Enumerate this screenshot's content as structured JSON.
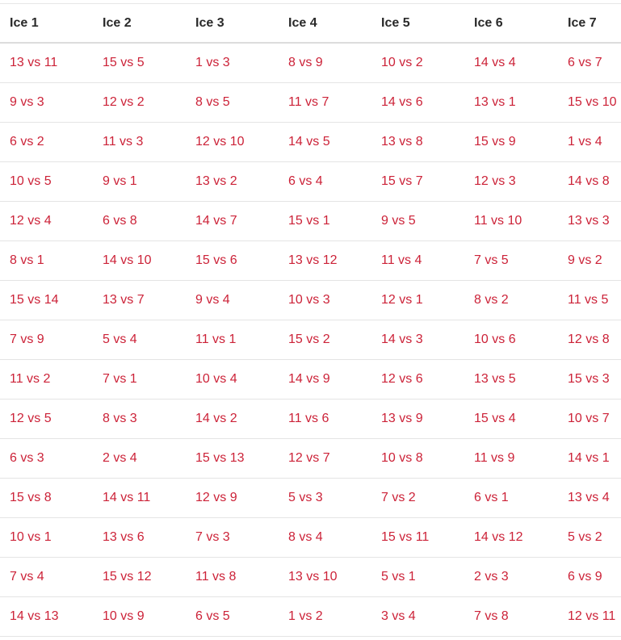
{
  "table": {
    "headers": [
      "Ice 1",
      "Ice 2",
      "Ice 3",
      "Ice 4",
      "Ice 5",
      "Ice 6",
      "Ice 7"
    ],
    "rows": [
      [
        "13 vs 11",
        "15 vs 5",
        "1 vs 3",
        "8 vs 9",
        "10 vs 2",
        "14 vs 4",
        "6 vs 7"
      ],
      [
        "9 vs 3",
        "12 vs 2",
        "8 vs 5",
        "11 vs 7",
        "14 vs 6",
        "13 vs 1",
        "15 vs 10"
      ],
      [
        "6 vs 2",
        "11 vs 3",
        "12 vs 10",
        "14 vs 5",
        "13 vs 8",
        "15 vs 9",
        "1 vs 4"
      ],
      [
        "10 vs 5",
        "9 vs 1",
        "13 vs 2",
        "6 vs 4",
        "15 vs 7",
        "12 vs 3",
        "14 vs 8"
      ],
      [
        "12 vs 4",
        "6 vs 8",
        "14 vs 7",
        "15 vs 1",
        "9 vs 5",
        "11 vs 10",
        "13 vs 3"
      ],
      [
        "8 vs 1",
        "14 vs 10",
        "15 vs 6",
        "13 vs 12",
        "11 vs 4",
        "7 vs 5",
        "9 vs 2"
      ],
      [
        "15 vs 14",
        "13 vs 7",
        "9 vs 4",
        "10 vs 3",
        "12 vs 1",
        "8 vs 2",
        "11 vs 5"
      ],
      [
        "7 vs 9",
        "5 vs 4",
        "11 vs 1",
        "15 vs 2",
        "14 vs 3",
        "10 vs 6",
        "12 vs 8"
      ],
      [
        "11 vs 2",
        "7 vs 1",
        "10 vs 4",
        "14 vs 9",
        "12 vs 6",
        "13 vs 5",
        "15 vs 3"
      ],
      [
        "12 vs 5",
        "8 vs 3",
        "14 vs 2",
        "11 vs 6",
        "13 vs 9",
        "15 vs 4",
        "10 vs 7"
      ],
      [
        "6 vs 3",
        "2 vs 4",
        "15 vs 13",
        "12 vs 7",
        "10 vs 8",
        "11 vs 9",
        "14 vs 1"
      ],
      [
        "15 vs 8",
        "14 vs 11",
        "12 vs 9",
        "5 vs 3",
        "7 vs 2",
        "6 vs 1",
        "13 vs 4"
      ],
      [
        "10 vs 1",
        "13 vs 6",
        "7 vs 3",
        "8 vs 4",
        "15 vs 11",
        "14 vs 12",
        "5 vs 2"
      ],
      [
        "7 vs 4",
        "15 vs 12",
        "11 vs 8",
        "13 vs 10",
        "5 vs 1",
        "2 vs 3",
        "6 vs 9"
      ],
      [
        "14 vs 13",
        "10 vs 9",
        "6 vs 5",
        "1 vs 2",
        "3 vs 4",
        "7 vs 8",
        "12 vs 11"
      ]
    ]
  },
  "colors": {
    "link": "#cc2238",
    "header_text": "#2a2a2a",
    "divider": "#e4e4e4"
  }
}
